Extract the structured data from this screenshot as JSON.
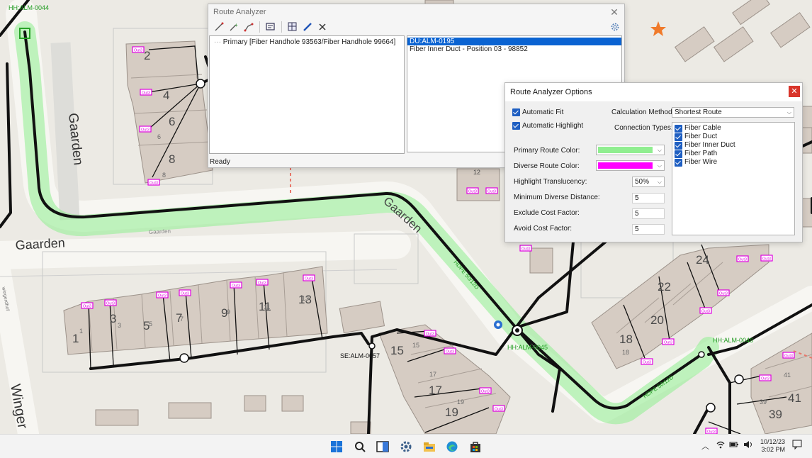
{
  "map": {
    "labels": {
      "street_gaarden_vertical": "Gaarden",
      "street_gaarden_horizontal": "Gaarden",
      "street_gaarden_diagonal": "Gaarden",
      "street_gaarden_small": "Gaarden",
      "street_wingerd": "Winger",
      "street_small_left": "wingerdhof",
      "handhole_top": "HH:ALM-0044",
      "handhole_center": "HH:ALM-0045",
      "handhole_right": "HH:ALM-0046",
      "splice_enclosure": "SE:ALM-0057",
      "duct_label_1": "HDPE 50/12D",
      "duct_label_2": "HDPE 50/12D",
      "house_numbers": [
        "2",
        "4",
        "6",
        "8",
        "1",
        "3",
        "5",
        "7",
        "9",
        "11",
        "13",
        "12",
        "15",
        "17",
        "19",
        "18",
        "20",
        "22",
        "24",
        "39",
        "41"
      ],
      "small_numbers": [
        "6",
        "8",
        "1",
        "3",
        "5",
        "7",
        "9",
        "11",
        "13",
        "17",
        "19",
        "18",
        "39",
        "41",
        "15"
      ],
      "tag": "Out3"
    },
    "colors": {
      "route_highlight": "#90ee90",
      "tag_color": "#e000e0",
      "cable_color": "#111111",
      "star_color": "#f07a2a"
    }
  },
  "route_analyzer": {
    "title": "Route Analyzer",
    "toolbar_icons": [
      "trace-icon",
      "add-point-icon",
      "route-icon",
      "report-icon",
      "grid-icon",
      "pencil-icon",
      "clear-icon"
    ],
    "tree_items": [
      "Primary [Fiber Handhole 93563/Fiber Handhole 99664]"
    ],
    "list_items": [
      {
        "label": "DU:ALM-0195",
        "selected": true
      },
      {
        "label": "Fiber Inner Duct - Position 03 - 98852",
        "selected": false
      }
    ],
    "status": "Ready"
  },
  "options_dialog": {
    "title": "Route Analyzer Options",
    "automatic_fit_label": "Automatic Fit",
    "automatic_highlight_label": "Automatic Highlight",
    "calculation_method_label": "Calculation Method:",
    "calculation_method_value": "Shortest Route",
    "connection_types_label": "Connection Types:",
    "connection_types": [
      "Fiber Cable",
      "Fiber Duct",
      "Fiber Inner Duct",
      "Fiber Path",
      "Fiber Wire"
    ],
    "primary_route_color_label": "Primary Route Color:",
    "primary_route_color": "#90ee90",
    "diverse_route_color_label": "Diverse Route Color:",
    "diverse_route_color": "#ff00ff",
    "highlight_translucency_label": "Highlight Translucency:",
    "highlight_translucency_value": "50%",
    "min_diverse_distance_label": "Minimum Diverse Distance:",
    "min_diverse_distance_value": "5",
    "exclude_cost_factor_label": "Exclude Cost Factor:",
    "exclude_cost_factor_value": "5",
    "avoid_cost_factor_label": "Avoid Cost Factor:",
    "avoid_cost_factor_value": "5"
  },
  "taskbar": {
    "icons": [
      "start-icon",
      "search-icon",
      "task-view-icon",
      "settings-icon",
      "file-explorer-icon",
      "edge-icon",
      "store-icon"
    ],
    "tray_icons": [
      "chevron-up-icon",
      "wifi-icon",
      "battery-icon",
      "volume-icon",
      "notification-icon"
    ],
    "date": "10/12/23",
    "time": "3:02 PM"
  }
}
